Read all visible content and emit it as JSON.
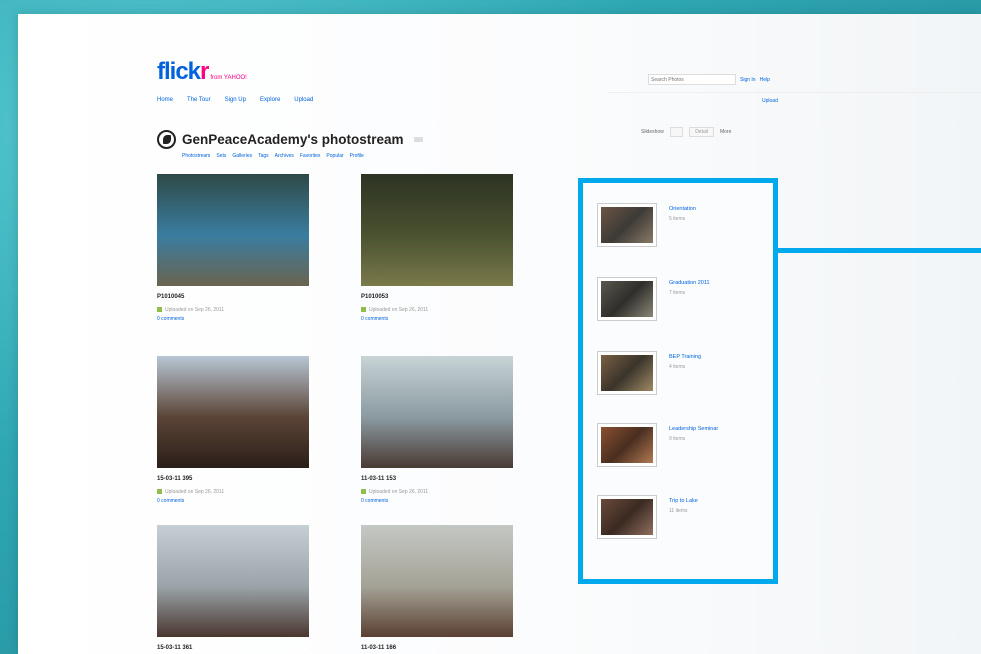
{
  "header": {
    "logo_main": "flick",
    "logo_r": "r",
    "logo_tag": "from YAHOO!",
    "nav": [
      "Home",
      "The Tour",
      "Sign Up",
      "Explore",
      "Upload"
    ],
    "search_placeholder": "Search Photos",
    "sign_in": "Sign In",
    "help": "Help",
    "upload_link": "Upload"
  },
  "page": {
    "title": "GenPeaceAcademy's photostream",
    "subnav": [
      "Photostream",
      "Sets",
      "Galleries",
      "Tags",
      "Archives",
      "Favorites",
      "Popular",
      "Profile"
    ],
    "view_label": "Slideshow",
    "view_btn": "Detail",
    "more_label": "More"
  },
  "photos": [
    {
      "title": "P1010045",
      "meta1": "Uploaded on Sep 26, 2011",
      "meta2": "0 comments",
      "colors": [
        "#2e4a47",
        "#3a7da0",
        "#6a6450"
      ]
    },
    {
      "title": "P1010053",
      "meta1": "Uploaded on Sep 26, 2011",
      "meta2": "0 comments",
      "colors": [
        "#2d3322",
        "#4a5230",
        "#7a7a4a"
      ]
    },
    {
      "title": "15-03-11 395",
      "meta1": "Uploaded on Sep 26, 2011",
      "meta2": "0 comments",
      "colors": [
        "#b8c6d4",
        "#5b4436",
        "#2a1e18"
      ]
    },
    {
      "title": "11-03-11 153",
      "meta1": "Uploaded on Sep 26, 2011",
      "meta2": "0 comments",
      "colors": [
        "#c8d4d6",
        "#8a9aa0",
        "#4a3a34"
      ]
    },
    {
      "title": "15-03-11 361",
      "meta1": "",
      "meta2": "",
      "colors": [
        "#c6cfd4",
        "#9aa4a8",
        "#4a3630"
      ]
    },
    {
      "title": "11-03-11 166",
      "meta1": "",
      "meta2": "",
      "colors": [
        "#c4c8c4",
        "#a4a296",
        "#5a4032"
      ]
    }
  ],
  "sets": [
    {
      "name": "Orientation",
      "items": "5 items",
      "colors": [
        "#6a5544",
        "#3d3a36",
        "#8a7a66"
      ]
    },
    {
      "name": "Graduation 2011",
      "items": "7 items",
      "colors": [
        "#5b574f",
        "#2f2e2a",
        "#8a8678"
      ]
    },
    {
      "name": "BEP Training",
      "items": "4 items",
      "colors": [
        "#7a6044",
        "#3a342a",
        "#a08a66"
      ]
    },
    {
      "name": "Leadership Seminar",
      "items": "9 items",
      "colors": [
        "#8a5030",
        "#4a2e20",
        "#b07a52"
      ]
    },
    {
      "name": "Trip to Lake",
      "items": "11 items",
      "colors": [
        "#6a4a3a",
        "#3a2a22",
        "#907060"
      ]
    }
  ]
}
